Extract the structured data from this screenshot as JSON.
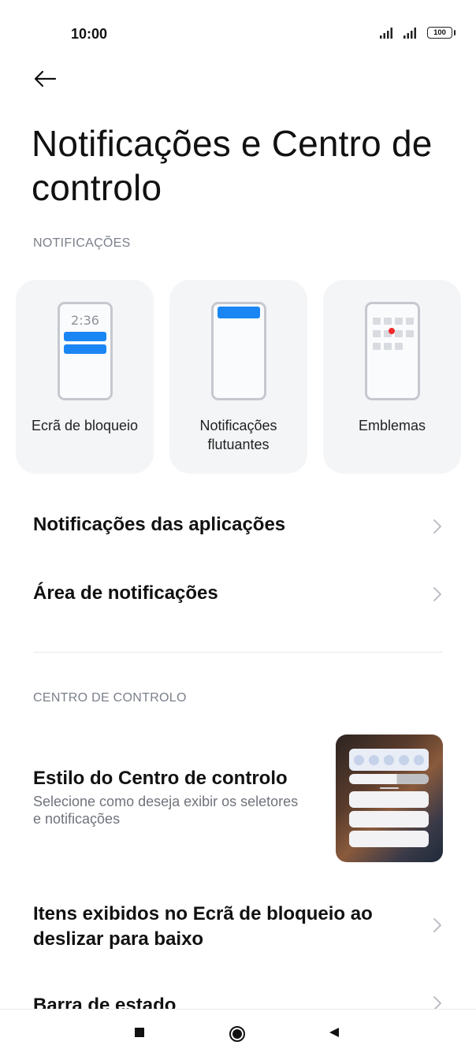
{
  "status_bar": {
    "time": "10:00",
    "battery": "100"
  },
  "page": {
    "title": "Notificações e Centro de controlo"
  },
  "sections": {
    "notifications_header": "NOTIFICAÇÕES",
    "control_center_header": "CENTRO DE CONTROLO"
  },
  "cards": [
    {
      "label": "Ecrã de bloqueio",
      "preview_time": "2:36"
    },
    {
      "label": "Notificações flutuantes"
    },
    {
      "label": "Emblemas"
    }
  ],
  "rows": {
    "app_notifications": "Notificações das aplicações",
    "notification_area": "Área de notificações",
    "cc_style_title": "Estilo do Centro de controlo",
    "cc_style_subtitle": "Selecione como deseja exibir os seletores e notificações",
    "lockscreen_items": "Itens exibidos no Ecrã de bloqueio ao deslizar para baixo",
    "status_bar": "Barra de estado"
  },
  "colors": {
    "accent": "#1a86f4",
    "badge": "#ef2a2a",
    "secondary_text": "#7a7f8a"
  },
  "icons": {
    "back": "arrow-left-icon",
    "chevron": "chevron-right-icon",
    "nav_recent": "square-icon",
    "nav_home": "circle-icon",
    "nav_back": "triangle-left-icon"
  }
}
